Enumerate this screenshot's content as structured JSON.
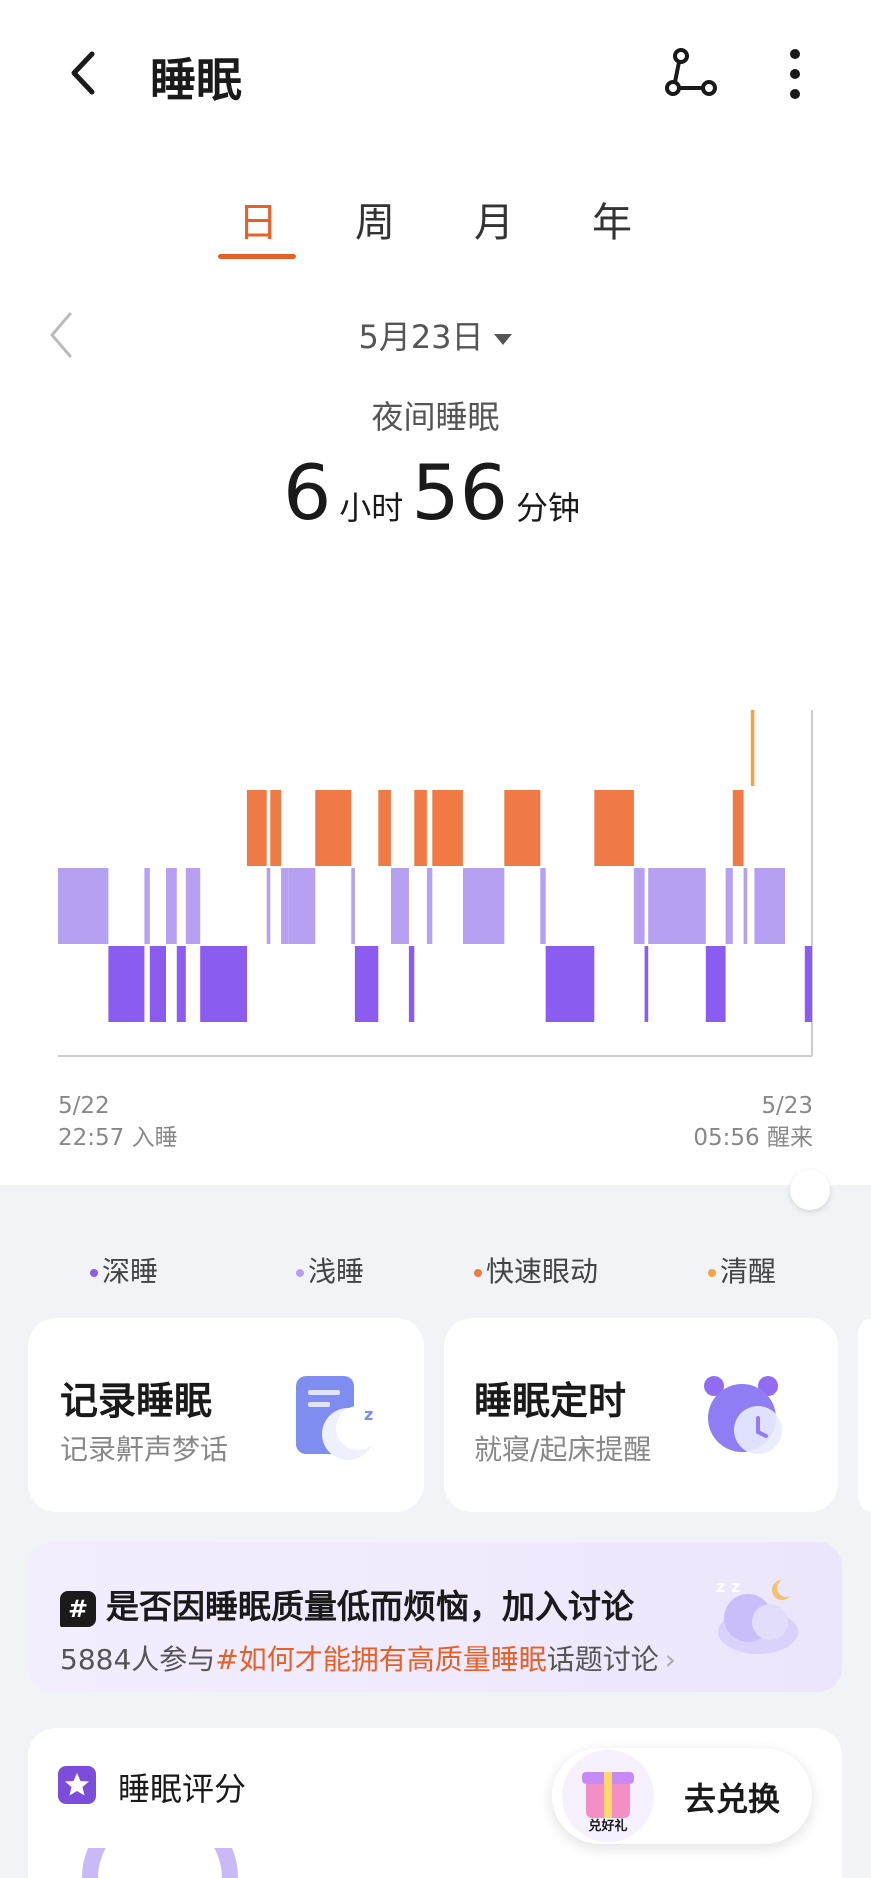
{
  "header": {
    "title": "睡眠"
  },
  "tabs": [
    {
      "label": "日",
      "active": true
    },
    {
      "label": "周",
      "active": false
    },
    {
      "label": "月",
      "active": false
    },
    {
      "label": "年",
      "active": false
    }
  ],
  "date_selector": {
    "date": "5月23日"
  },
  "summary": {
    "label": "夜间睡眠",
    "hours": "6",
    "hours_unit": "小时",
    "minutes": "56",
    "minutes_unit": "分钟"
  },
  "sleep_start": {
    "date": "5/22",
    "time": "22:57 入睡"
  },
  "sleep_end": {
    "date": "5/23",
    "time": "05:56 醒来"
  },
  "legend": [
    {
      "label": "深睡",
      "color": "#8a5cf0"
    },
    {
      "label": "浅睡",
      "color": "#b6a0f2"
    },
    {
      "label": "快速眼动",
      "color": "#f07a45"
    },
    {
      "label": "清醒",
      "color": "#f2a541"
    }
  ],
  "cards": [
    {
      "title": "记录睡眠",
      "subtitle": "记录鼾声梦话",
      "icon": "moon-note-icon"
    },
    {
      "title": "睡眠定时",
      "subtitle": "就寝/起床提醒",
      "icon": "alarm-clock-icon"
    }
  ],
  "topic": {
    "title": "是否因睡眠质量低而烦恼，加入讨论",
    "count_text": "5884人参与",
    "tag": "#如何才能拥有高质量睡眠",
    "suffix": "话题讨论"
  },
  "score": {
    "title": "睡眠评分"
  },
  "redeem": {
    "label": "去兑换",
    "badge_text": "兑好礼"
  },
  "chart_data": {
    "type": "hypnogram",
    "start": "22:57",
    "end": "05:56",
    "stages": [
      "清醒",
      "快速眼动",
      "浅睡",
      "深睡"
    ],
    "segments": [
      {
        "stage": "浅睡",
        "start": "22:57",
        "end": "23:25"
      },
      {
        "stage": "深睡",
        "start": "23:25",
        "end": "23:45"
      },
      {
        "stage": "浅睡",
        "start": "23:45",
        "end": "23:48"
      },
      {
        "stage": "深睡",
        "start": "23:48",
        "end": "23:57"
      },
      {
        "stage": "浅睡",
        "start": "23:57",
        "end": "24:03"
      },
      {
        "stage": "深睡",
        "start": "24:03",
        "end": "24:08"
      },
      {
        "stage": "浅睡",
        "start": "24:08",
        "end": "24:16"
      },
      {
        "stage": "深睡",
        "start": "24:16",
        "end": "24:42"
      },
      {
        "stage": "快速眼动",
        "start": "24:42",
        "end": "24:53"
      },
      {
        "stage": "浅睡",
        "start": "24:53",
        "end": "24:55"
      },
      {
        "stage": "快速眼动",
        "start": "24:55",
        "end": "25:01"
      },
      {
        "stage": "浅睡",
        "start": "25:01",
        "end": "25:05"
      },
      {
        "stage": "浅睡",
        "start": "25:05",
        "end": "25:20"
      },
      {
        "stage": "快速眼动",
        "start": "25:20",
        "end": "25:40"
      },
      {
        "stage": "浅睡",
        "start": "25:40",
        "end": "25:42"
      },
      {
        "stage": "深睡",
        "start": "25:42",
        "end": "25:55"
      },
      {
        "stage": "快速眼动",
        "start": "25:55",
        "end": "26:02"
      },
      {
        "stage": "浅睡",
        "start": "26:02",
        "end": "26:12"
      },
      {
        "stage": "深睡",
        "start": "26:12",
        "end": "26:15"
      },
      {
        "stage": "快速眼动",
        "start": "26:15",
        "end": "26:22"
      },
      {
        "stage": "浅睡",
        "start": "26:22",
        "end": "26:25"
      },
      {
        "stage": "快速眼动",
        "start": "26:25",
        "end": "26:42"
      },
      {
        "stage": "浅睡",
        "start": "26:42",
        "end": "27:05"
      },
      {
        "stage": "快速眼动",
        "start": "27:05",
        "end": "27:25"
      },
      {
        "stage": "浅睡",
        "start": "27:25",
        "end": "27:28"
      },
      {
        "stage": "深睡",
        "start": "27:28",
        "end": "27:55"
      },
      {
        "stage": "快速眼动",
        "start": "27:55",
        "end": "28:17"
      },
      {
        "stage": "浅睡",
        "start": "28:17",
        "end": "28:23"
      },
      {
        "stage": "深睡",
        "start": "28:23",
        "end": "28:25"
      },
      {
        "stage": "浅睡",
        "start": "28:25",
        "end": "28:57"
      },
      {
        "stage": "深睡",
        "start": "28:57",
        "end": "29:08"
      },
      {
        "stage": "浅睡",
        "start": "29:08",
        "end": "29:12"
      },
      {
        "stage": "快速眼动",
        "start": "29:12",
        "end": "29:18"
      },
      {
        "stage": "浅睡",
        "start": "29:18",
        "end": "29:20"
      },
      {
        "stage": "清醒",
        "start": "29:22",
        "end": "29:24"
      },
      {
        "stage": "浅睡",
        "start": "29:24",
        "end": "29:41"
      },
      {
        "stage": "深睡",
        "start": "29:52",
        "end": "29:56"
      }
    ]
  }
}
